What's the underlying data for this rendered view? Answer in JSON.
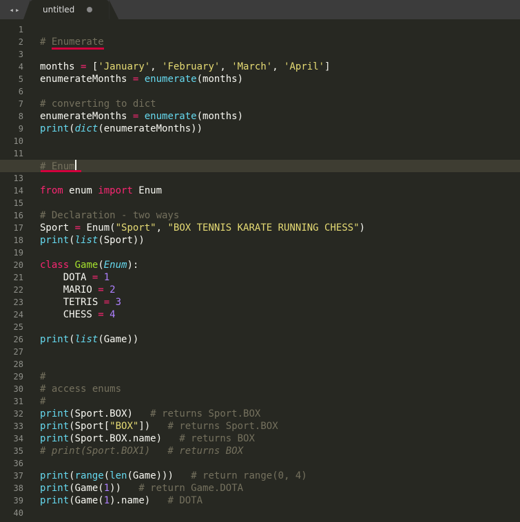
{
  "tabbar": {
    "nav_left": "◂",
    "nav_right": "▸",
    "tab_title": "untitled"
  },
  "gutter": {
    "start": 1,
    "end": 40
  },
  "code": {
    "lines": [
      [],
      [
        [
          "c",
          "# "
        ],
        [
          "c underline-red",
          "Enumerate"
        ]
      ],
      [],
      [
        [
          "p",
          "months "
        ],
        [
          "o",
          "="
        ],
        [
          "p",
          " ["
        ],
        [
          "s",
          "'January'"
        ],
        [
          "p",
          ", "
        ],
        [
          "s",
          "'February'"
        ],
        [
          "p",
          ", "
        ],
        [
          "s",
          "'March'"
        ],
        [
          "p",
          ", "
        ],
        [
          "s",
          "'April'"
        ],
        [
          "p",
          "]"
        ]
      ],
      [
        [
          "p",
          "enumerateMonths "
        ],
        [
          "o",
          "="
        ],
        [
          "p",
          " "
        ],
        [
          "f",
          "enumerate"
        ],
        [
          "p",
          "(months)"
        ]
      ],
      [],
      [
        [
          "c",
          "# converting to dict"
        ]
      ],
      [
        [
          "p",
          "enumerateMonths "
        ],
        [
          "o",
          "="
        ],
        [
          "p",
          " "
        ],
        [
          "f",
          "enumerate"
        ],
        [
          "p",
          "(months)"
        ]
      ],
      [
        [
          "f",
          "print"
        ],
        [
          "p",
          "("
        ],
        [
          "f-i",
          "dict"
        ],
        [
          "p",
          "(enumerateMonths))"
        ]
      ],
      [],
      [],
      [
        [
          "c",
          "# Enum"
        ],
        [
          "caret",
          ""
        ]
      ],
      [],
      [
        [
          "k",
          "from"
        ],
        [
          "p",
          " enum "
        ],
        [
          "k",
          "import"
        ],
        [
          "p",
          " Enum"
        ]
      ],
      [],
      [
        [
          "c",
          "# Declaration - two ways"
        ]
      ],
      [
        [
          "p",
          "Sport "
        ],
        [
          "o",
          "="
        ],
        [
          "p",
          " Enum("
        ],
        [
          "s",
          "\"Sport\""
        ],
        [
          "p",
          ", "
        ],
        [
          "s",
          "\"BOX TENNIS KARATE RUNNING CHESS\""
        ],
        [
          "p",
          ")"
        ]
      ],
      [
        [
          "f",
          "print"
        ],
        [
          "p",
          "("
        ],
        [
          "f-i",
          "list"
        ],
        [
          "p",
          "(Sport))"
        ]
      ],
      [],
      [
        [
          "k",
          "class"
        ],
        [
          "p",
          " "
        ],
        [
          "d",
          "Game"
        ],
        [
          "p",
          "("
        ],
        [
          "f-i",
          "Enum"
        ],
        [
          "p",
          "):"
        ]
      ],
      [
        [
          "p",
          "    DOTA "
        ],
        [
          "o",
          "="
        ],
        [
          "p",
          " "
        ],
        [
          "n",
          "1"
        ]
      ],
      [
        [
          "p",
          "    MARIO "
        ],
        [
          "o",
          "="
        ],
        [
          "p",
          " "
        ],
        [
          "n",
          "2"
        ]
      ],
      [
        [
          "p",
          "    TETRIS "
        ],
        [
          "o",
          "="
        ],
        [
          "p",
          " "
        ],
        [
          "n",
          "3"
        ]
      ],
      [
        [
          "p",
          "    CHESS "
        ],
        [
          "o",
          "="
        ],
        [
          "p",
          " "
        ],
        [
          "n",
          "4"
        ]
      ],
      [],
      [
        [
          "f",
          "print"
        ],
        [
          "p",
          "("
        ],
        [
          "f-i",
          "list"
        ],
        [
          "p",
          "(Game))"
        ]
      ],
      [],
      [],
      [
        [
          "c",
          "#"
        ]
      ],
      [
        [
          "c",
          "# access enums"
        ]
      ],
      [
        [
          "c",
          "#"
        ]
      ],
      [
        [
          "f",
          "print"
        ],
        [
          "p",
          "(Sport.BOX)   "
        ],
        [
          "c",
          "# returns Sport.BOX"
        ]
      ],
      [
        [
          "f",
          "print"
        ],
        [
          "p",
          "(Sport["
        ],
        [
          "s",
          "\"BOX\""
        ],
        [
          "p",
          "])   "
        ],
        [
          "c",
          "# returns Sport.BOX"
        ]
      ],
      [
        [
          "f",
          "print"
        ],
        [
          "p",
          "(Sport.BOX.name)   "
        ],
        [
          "c",
          "# returns BOX"
        ]
      ],
      [
        [
          "c-i",
          "# print(Sport.BOX1)   # returns BOX"
        ]
      ],
      [],
      [
        [
          "f",
          "print"
        ],
        [
          "p",
          "("
        ],
        [
          "f",
          "range"
        ],
        [
          "p",
          "("
        ],
        [
          "f",
          "len"
        ],
        [
          "p",
          "(Game)))   "
        ],
        [
          "c",
          "# return range(0, 4)"
        ]
      ],
      [
        [
          "f",
          "print"
        ],
        [
          "p",
          "(Game("
        ],
        [
          "n",
          "1"
        ],
        [
          "p",
          "))   "
        ],
        [
          "c",
          "# return Game.DOTA"
        ]
      ],
      [
        [
          "f",
          "print"
        ],
        [
          "p",
          "(Game("
        ],
        [
          "n",
          "1"
        ],
        [
          "p",
          ").name)   "
        ],
        [
          "c",
          "# DOTA"
        ]
      ],
      []
    ],
    "current_line_index": 11
  },
  "annotations": {
    "underline2": {
      "line": 12,
      "left_ch": 2,
      "width_ch": 7
    }
  }
}
